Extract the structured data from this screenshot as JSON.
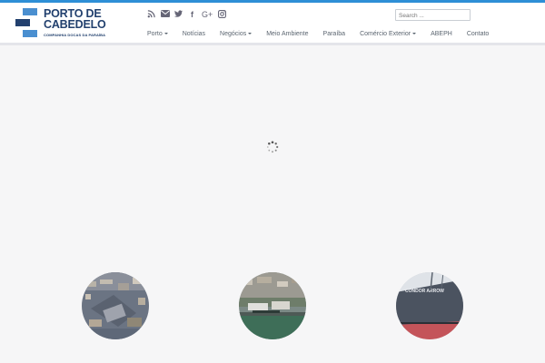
{
  "header": {
    "logo_line1": "PORTO DE",
    "logo_line2": "CABEDELO",
    "logo_sub": "COMPANHIA DOCAS DA PARAÍBA"
  },
  "social_icons": [
    "rss-icon",
    "envelope-icon",
    "twitter-icon",
    "facebook-icon",
    "google-plus-icon",
    "instagram-icon"
  ],
  "search": {
    "placeholder": "Search ..."
  },
  "nav": {
    "items": [
      {
        "label": "Porto",
        "dropdown": true
      },
      {
        "label": "Notícias",
        "dropdown": false
      },
      {
        "label": "Negócios",
        "dropdown": true
      },
      {
        "label": "Meio Ambiente",
        "dropdown": false
      },
      {
        "label": "Paraíba",
        "dropdown": false
      },
      {
        "label": "Comércio Exterior",
        "dropdown": true
      },
      {
        "label": "ABEPH",
        "dropdown": false
      },
      {
        "label": "Contato",
        "dropdown": false
      }
    ]
  },
  "colors": {
    "accent": "#2e8fd6",
    "brand_dark": "#22406e",
    "brand_light": "#4a8fd0",
    "hero_bg": "#f6f6f7"
  },
  "feature_cards": [
    {
      "image": "aerial-city-photo"
    },
    {
      "image": "aerial-port-photo"
    },
    {
      "image": "ship-hull-photo"
    }
  ]
}
